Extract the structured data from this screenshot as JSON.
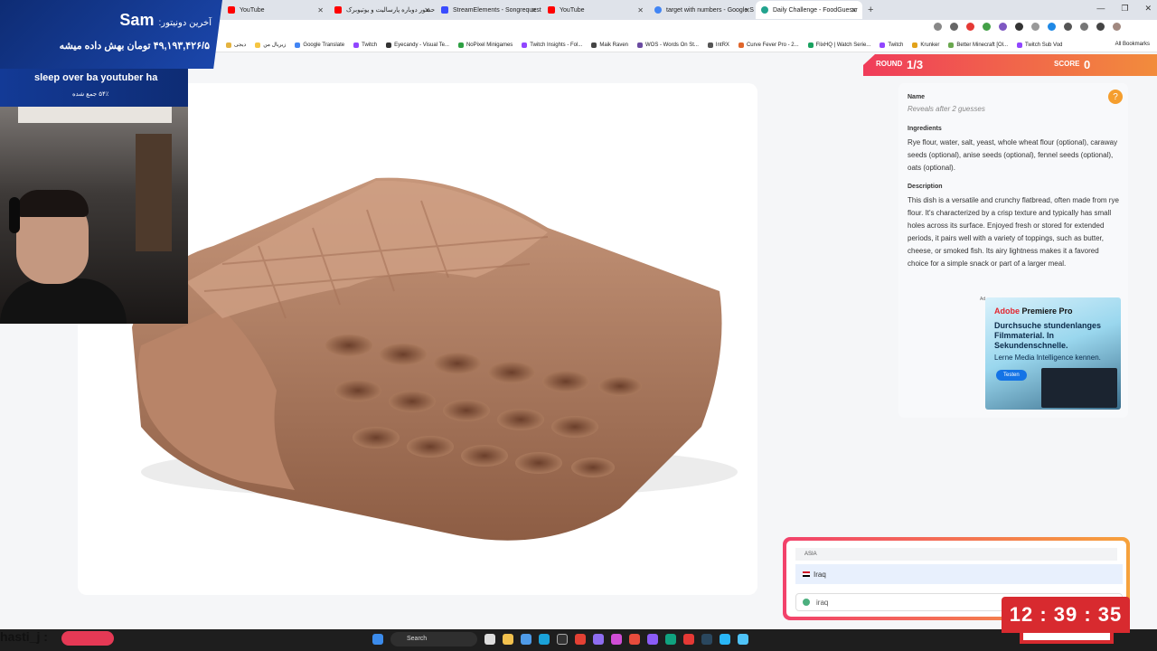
{
  "browser": {
    "tabs": [
      {
        "title": "YouTube",
        "favicon_color": "#ff0000",
        "active": false
      },
      {
        "title": "حضور دوباره پارسالیت و یوتیوبرک",
        "favicon_color": "#ff0000",
        "active": false
      },
      {
        "title": "StreamElements - Songrequest",
        "favicon_color": "#3a4cff",
        "active": false
      },
      {
        "title": "YouTube",
        "favicon_color": "#ff0000",
        "active": false
      },
      {
        "title": "target with numbers - Google S",
        "favicon_color": "#4285f4",
        "active": false
      },
      {
        "title": "Daily Challenge - FoodGuessr",
        "favicon_color": "#22a38e",
        "active": true
      }
    ],
    "new_tab": "+",
    "bookmarks": [
      {
        "label": "دیجی",
        "color": "#e4b340"
      },
      {
        "label": "زیریال من",
        "color": "#f5c542"
      },
      {
        "label": "Google Translate",
        "color": "#4285f4"
      },
      {
        "label": "Twitch",
        "color": "#9146ff"
      },
      {
        "label": "Eyecandy - Visual Te...",
        "color": "#333333"
      },
      {
        "label": "NoPixel Minigames",
        "color": "#2ea043"
      },
      {
        "label": "Twitch Insights - Fol...",
        "color": "#9146ff"
      },
      {
        "label": "Maik Raven",
        "color": "#444444"
      },
      {
        "label": "WOS - Words On St...",
        "color": "#6b4ba1"
      },
      {
        "label": "IntRX",
        "color": "#555555"
      },
      {
        "label": "Curve Fever Pro - 2...",
        "color": "#e0662b"
      },
      {
        "label": "FlixHQ | Watch Serie...",
        "color": "#1aa260"
      },
      {
        "label": "Twitch",
        "color": "#9146ff"
      },
      {
        "label": "Krunker",
        "color": "#e2a21a"
      },
      {
        "label": "Better Minecraft [Ol...",
        "color": "#6aa84f"
      },
      {
        "label": "Twitch Sub Vod",
        "color": "#9146ff"
      }
    ],
    "all_bookmarks": "All Bookmarks"
  },
  "game": {
    "round_label": "ROUND",
    "round_value": "1/3",
    "score_label": "SCORE",
    "score_value": "0",
    "panel": {
      "name_heading": "Name",
      "name_value": "Reveals after 2 guesses",
      "ingredients_heading": "Ingredients",
      "ingredients_text": "Rye flour, water, salt, yeast, whole wheat flour (optional), caraway seeds (optional), anise seeds (optional), fennel seeds (optional), oats (optional).",
      "description_heading": "Description",
      "description_text": "This dish is a versatile and crunchy flatbread, often made from rye flour. It's characterized by a crisp texture and typically has small holes across its surface. Enjoyed fresh or stored for extended periods, it pairs well with a variety of toppings, such as butter, cheese, or smoked fish. Its airy lightness makes it a favored choice for a simple snack or part of a larger meal.",
      "help_icon": "?"
    },
    "ad": {
      "tag": "Ad",
      "brand_prefix": "Adobe",
      "brand_name": "Premiere Pro",
      "headline": "Durchsuche stundenlanges Filmmaterial. In Sekundenschnelle.",
      "subline": "Lerne Media Intelligence kennen.",
      "cta": "Testen"
    },
    "guess": {
      "group_label": "ASIA",
      "option_label": "Iraq",
      "input_value": "iraq"
    }
  },
  "stream_overlay": {
    "donor_label": "آخرین دونیتور:",
    "donor_name": "Sam",
    "amount_text": "۴۹,۱۹۳,۴۲۶/۵ تومان بهش داده میشه",
    "goal_title": "sleep over ba youtuber ha",
    "goal_progress": "۵۴٪ جمع شده",
    "chat_user": "hasti_j :",
    "clock": "12 : 39 : 35"
  },
  "taskbar": {
    "search_label": "Search"
  }
}
